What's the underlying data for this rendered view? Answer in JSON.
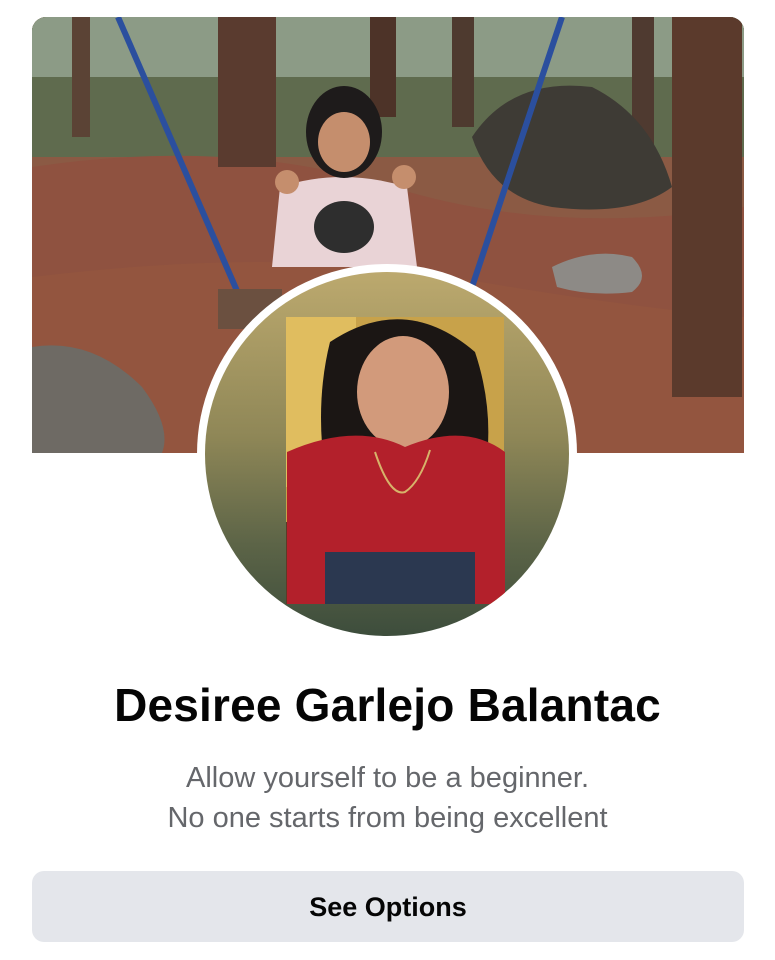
{
  "profile": {
    "name": "Desiree Garlejo Balantac",
    "bio_line1": "Allow yourself to be a beginner.",
    "bio_line2": "No one starts from being excellent"
  },
  "actions": {
    "see_options_label": "See Options"
  },
  "images": {
    "cover_photo": "cover-photo",
    "profile_photo": "profile-photo"
  },
  "colors": {
    "name_text": "#050505",
    "bio_text": "#65676b",
    "button_bg": "#e4e6eb"
  }
}
